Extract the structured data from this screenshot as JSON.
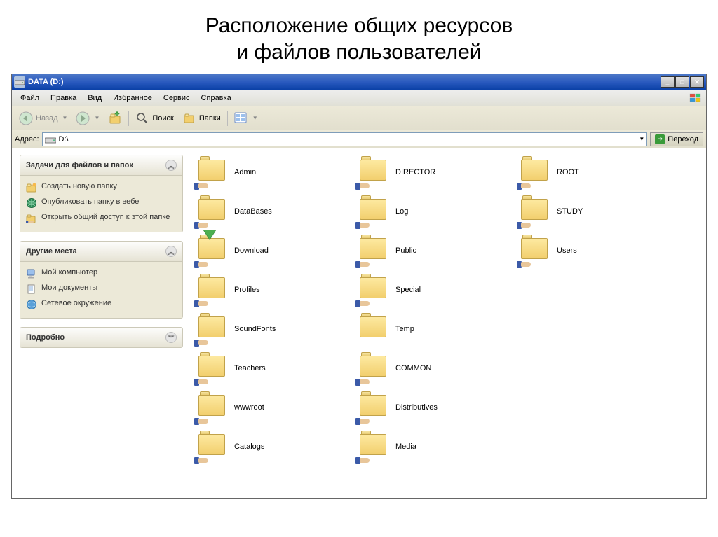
{
  "slide": {
    "title": "Расположение общих ресурсов\nи файлов пользователей"
  },
  "window": {
    "title": "DATA (D:)",
    "buttons": {
      "min": "_",
      "max": "□",
      "close": "✕"
    }
  },
  "menu": {
    "file": "Файл",
    "edit": "Правка",
    "view": "Вид",
    "favorites": "Избранное",
    "tools": "Сервис",
    "help": "Справка"
  },
  "toolbar": {
    "back": "Назад",
    "forward": "",
    "up": "",
    "search": "Поиск",
    "folders": "Папки",
    "views": ""
  },
  "address": {
    "label": "Адрес:",
    "value": "D:\\",
    "go": "Переход"
  },
  "side": {
    "tasks": {
      "title": "Задачи для файлов и папок",
      "new_folder": "Создать новую папку",
      "publish_web": "Опубликовать папку в вебе",
      "share_folder": "Открыть общий доступ к этой папке"
    },
    "places": {
      "title": "Другие места",
      "my_computer": "Мой компьютер",
      "my_documents": "Мои документы",
      "network": "Сетевое окружение"
    },
    "details": {
      "title": "Подробно"
    }
  },
  "folders": [
    {
      "name": "Admin",
      "shared": true,
      "download": false
    },
    {
      "name": "DataBases",
      "shared": true,
      "download": false
    },
    {
      "name": "Download",
      "shared": true,
      "download": true
    },
    {
      "name": "Profiles",
      "shared": true,
      "download": false
    },
    {
      "name": "SoundFonts",
      "shared": true,
      "download": false
    },
    {
      "name": "Teachers",
      "shared": true,
      "download": false
    },
    {
      "name": "wwwroot",
      "shared": true,
      "download": false
    },
    {
      "name": "Catalogs",
      "shared": true,
      "download": false
    },
    {
      "name": "DIRECTOR",
      "shared": true,
      "download": false
    },
    {
      "name": "Log",
      "shared": true,
      "download": false
    },
    {
      "name": "Public",
      "shared": true,
      "download": false
    },
    {
      "name": "Special",
      "shared": true,
      "download": false
    },
    {
      "name": "Temp",
      "shared": false,
      "download": false
    },
    {
      "name": "COMMON",
      "shared": true,
      "download": false
    },
    {
      "name": "Distributives",
      "shared": true,
      "download": false
    },
    {
      "name": "Media",
      "shared": true,
      "download": false
    },
    {
      "name": "ROOT",
      "shared": true,
      "download": false
    },
    {
      "name": "STUDY",
      "shared": true,
      "download": false
    },
    {
      "name": "Users",
      "shared": true,
      "download": false
    }
  ]
}
